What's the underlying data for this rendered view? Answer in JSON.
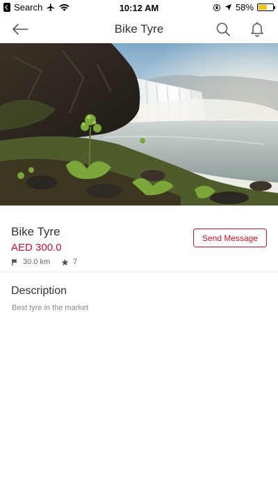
{
  "status_bar": {
    "back_label": "Search",
    "time": "10:12 AM",
    "battery_percent": "58%",
    "battery_level": 0.58,
    "battery_color": "#f3c512"
  },
  "nav": {
    "title": "Bike Tyre",
    "back_icon": "arrow-left-icon",
    "search_icon": "search-icon",
    "notification_icon": "bell-icon"
  },
  "listing": {
    "title": "Bike Tyre",
    "price": "AED 300.0",
    "distance": "30.0 km",
    "rating": "7",
    "send_message_label": "Send Message",
    "accent_color": "#c8102e"
  },
  "description": {
    "heading": "Description",
    "text": "Best tyre in the market"
  }
}
